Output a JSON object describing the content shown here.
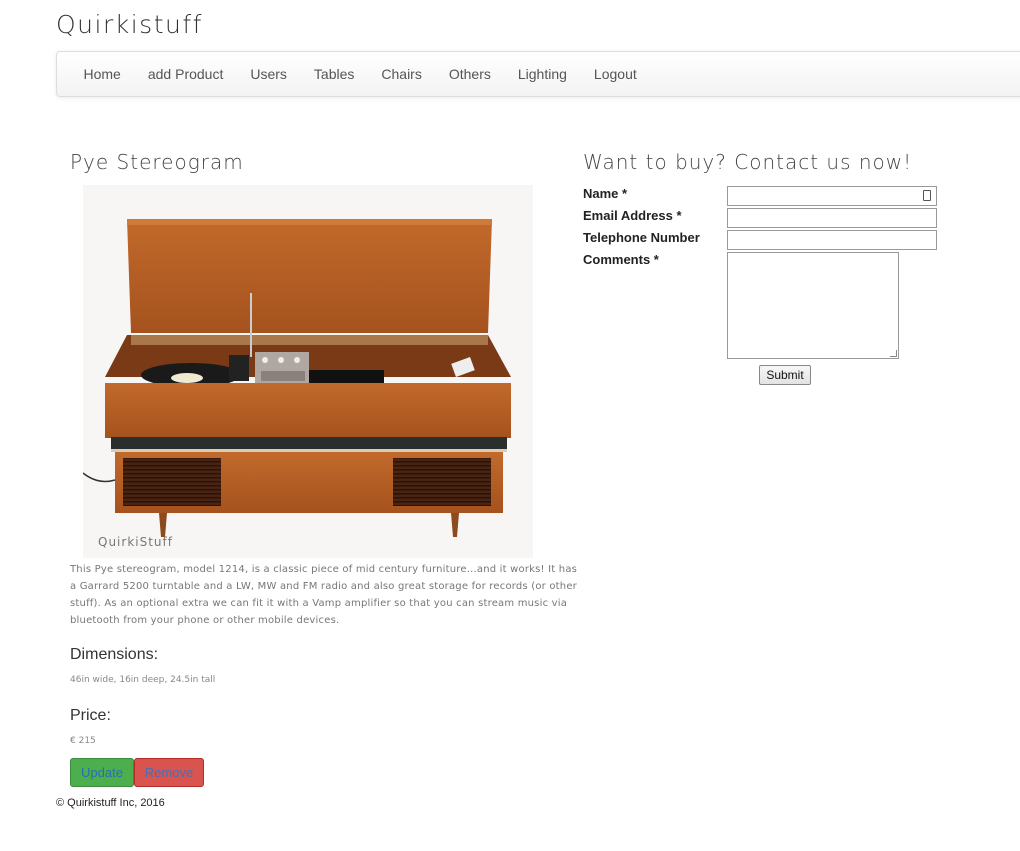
{
  "brand": "Quirkistuff",
  "nav": [
    "Home",
    "add Product",
    "Users",
    "Tables",
    "Chairs",
    "Others",
    "Lighting",
    "Logout"
  ],
  "product": {
    "title": "Pye Stereogram",
    "watermark": "QuirkiStuff",
    "description": "This Pye stereogram, model 1214, is a classic piece of mid century furniture...and it works! It has a Garrard 5200 turntable and a LW, MW and FM radio and also great storage for records (or other stuff). As an optional extra we can fit it with a Vamp amplifier so that you can stream music via bluetooth from your phone or other mobile devices.",
    "dimensions_heading": "Dimensions:",
    "dimensions": "46in wide, 16in deep, 24.5in tall",
    "price_heading": "Price:",
    "price": "€ 215",
    "update_label": "Update",
    "remove_label": "Remove"
  },
  "contact": {
    "title": "Want to buy? Contact us now!",
    "name_label": "Name *",
    "email_label": "Email Address *",
    "phone_label": "Telephone Number",
    "comments_label": "Comments *",
    "submit_label": "Submit"
  },
  "footer": "© Quirkistuff Inc, 2016"
}
